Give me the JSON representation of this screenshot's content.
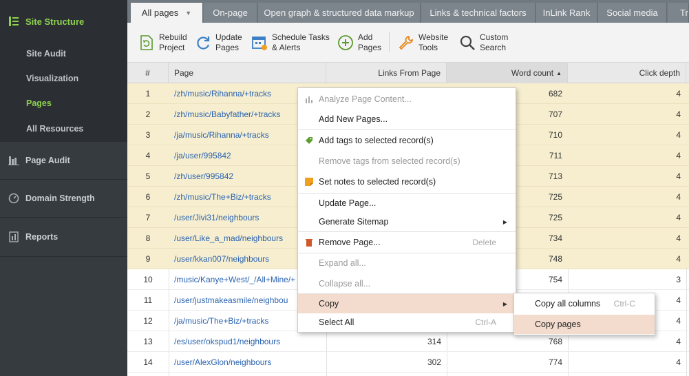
{
  "sidebar": {
    "site_structure": "Site Structure",
    "items": [
      {
        "label": "Site Audit"
      },
      {
        "label": "Visualization"
      },
      {
        "label": "Pages"
      },
      {
        "label": "All Resources"
      }
    ],
    "page_audit": "Page Audit",
    "domain_strength": "Domain Strength",
    "reports": "Reports",
    "accent_color": "#8fd14f"
  },
  "tabs": [
    {
      "label": "All pages"
    },
    {
      "label": "On-page"
    },
    {
      "label": "Open graph & structured data markup"
    },
    {
      "label": "Links & technical factors"
    },
    {
      "label": "InLink Rank"
    },
    {
      "label": "Social media"
    },
    {
      "label": "Tr"
    }
  ],
  "toolbar": {
    "rebuild": "Rebuild\nProject",
    "update": "Update\nPages",
    "schedule": "Schedule Tasks\n& Alerts",
    "add": "Add\nPages",
    "website_tools": "Website\nTools",
    "custom_search": "Custom\nSearch"
  },
  "table": {
    "headers": {
      "num": "#",
      "page": "Page",
      "links": "Links From Page",
      "word_count": "Word count",
      "click_depth": "Click depth"
    },
    "rows": [
      {
        "num": "1",
        "page": "/zh/music/Rihanna/+tracks",
        "links": "",
        "words": "682",
        "depth": "4"
      },
      {
        "num": "2",
        "page": "/zh/music/Babyfather/+tracks",
        "links": "",
        "words": "707",
        "depth": "4"
      },
      {
        "num": "3",
        "page": "/ja/music/Rihanna/+tracks",
        "links": "",
        "words": "710",
        "depth": "4"
      },
      {
        "num": "4",
        "page": "/ja/user/995842",
        "links": "",
        "words": "711",
        "depth": "4"
      },
      {
        "num": "5",
        "page": "/zh/user/995842",
        "links": "",
        "words": "713",
        "depth": "4"
      },
      {
        "num": "6",
        "page": "/zh/music/The+Biz/+tracks",
        "links": "",
        "words": "725",
        "depth": "4"
      },
      {
        "num": "7",
        "page": "/user/Jivi31/neighbours",
        "links": "",
        "words": "725",
        "depth": "4"
      },
      {
        "num": "8",
        "page": "/user/Like_a_mad/neighbours",
        "links": "",
        "words": "734",
        "depth": "4"
      },
      {
        "num": "9",
        "page": "/user/kkan007/neighbours",
        "links": "",
        "words": "748",
        "depth": "4"
      },
      {
        "num": "10",
        "page": "/music/Kanye+West/_/All+Mine/+",
        "links": "",
        "words": "754",
        "depth": "3"
      },
      {
        "num": "11",
        "page": "/user/justmakeasmile/neighbou",
        "links": "",
        "words": "",
        "depth": "4"
      },
      {
        "num": "12",
        "page": "/ja/music/The+Biz/+tracks",
        "links": "",
        "words": "",
        "depth": "4"
      },
      {
        "num": "13",
        "page": "/es/user/okspud1/neighbours",
        "links": "314",
        "words": "768",
        "depth": "4"
      },
      {
        "num": "14",
        "page": "/user/AlexGlon/neighbours",
        "links": "302",
        "words": "774",
        "depth": "4"
      }
    ]
  },
  "context_menu": {
    "analyze": "Analyze Page Content...",
    "add_new": "Add New Pages...",
    "add_tags": "Add tags to selected record(s)",
    "remove_tags": "Remove tags from selected record(s)",
    "set_notes": "Set notes to selected record(s)",
    "update_page": "Update Page...",
    "gen_sitemap": "Generate Sitemap",
    "remove_page": "Remove Page...",
    "remove_shortcut": "Delete",
    "expand": "Expand all...",
    "collapse": "Collapse all...",
    "copy": "Copy",
    "select_all": "Select All",
    "select_all_shortcut": "Ctrl-A"
  },
  "submenu": {
    "copy_all": "Copy all columns",
    "copy_all_shortcut": "Ctrl-C",
    "copy_pages": "Copy pages"
  }
}
